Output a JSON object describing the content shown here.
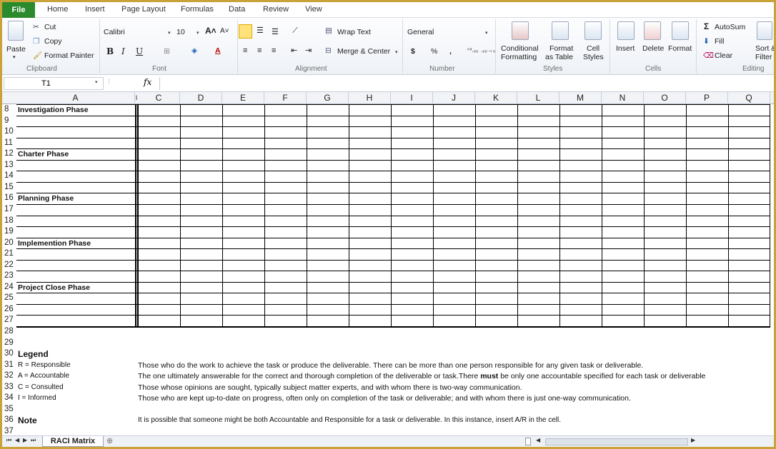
{
  "ribbon_tabs": {
    "file": "File",
    "home": "Home",
    "insert": "Insert",
    "page_layout": "Page Layout",
    "formulas": "Formulas",
    "data": "Data",
    "review": "Review",
    "view": "View"
  },
  "clipboard": {
    "paste": "Paste",
    "cut": "Cut",
    "copy": "Copy",
    "format_painter": "Format Painter",
    "group": "Clipboard"
  },
  "font": {
    "name": "Calibri",
    "size": "10",
    "bold": "B",
    "italic": "I",
    "underline": "U",
    "group": "Font"
  },
  "alignment": {
    "wrap_text": "Wrap Text",
    "merge_center": "Merge & Center",
    "group": "Alignment"
  },
  "number": {
    "format": "General",
    "currency": "$",
    "percent": "%",
    "comma": ",",
    "group": "Number"
  },
  "styles": {
    "conditional": "Conditional",
    "conditional2": "Formatting",
    "format_as": "Format",
    "format_as2": "as Table",
    "cell_styles": "Cell",
    "cell_styles2": "Styles",
    "group": "Styles"
  },
  "cells": {
    "insert": "Insert",
    "delete": "Delete",
    "format": "Format",
    "group": "Cells"
  },
  "editing": {
    "autosum": "AutoSum",
    "fill": "Fill",
    "clear": "Clear",
    "sort": "Sort &",
    "filter": "Filter",
    "group": "Editing"
  },
  "formula_bar": {
    "name_box": "T1",
    "fx": "fx",
    "value": ""
  },
  "columns": [
    "A",
    "I",
    "C",
    "D",
    "E",
    "F",
    "G",
    "H",
    "I",
    "J",
    "K",
    "L",
    "M",
    "N",
    "O",
    "P",
    "Q"
  ],
  "rows": [
    "8",
    "9",
    "10",
    "11",
    "12",
    "13",
    "14",
    "15",
    "16",
    "17",
    "18",
    "19",
    "20",
    "21",
    "22",
    "23",
    "24",
    "25",
    "26",
    "27",
    "28",
    "29",
    "30",
    "31",
    "32",
    "33",
    "34",
    "35",
    "36",
    "37"
  ],
  "phases": {
    "r8": "Investigation Phase",
    "r12": "Charter Phase",
    "r16": "Planning Phase",
    "r20": "Implemention Phase",
    "r24": "Project Close Phase"
  },
  "legend": {
    "title": "Legend",
    "r_code": "R = Responsible",
    "r_desc": "Those who do the work to achieve the task or produce the deliverable. There can be more than one person responsible for any given task or deliverable.",
    "a_code": "A = Accountable",
    "a_desc_pre": "The one ultimately answerable for the correct and thorough completion of the deliverable or task.There ",
    "a_desc_bold": "must",
    "a_desc_post": " be only one accountable specified for each task or deliverable",
    "c_code": "C = Consulted",
    "c_desc": "Those whose opinions are sought, typically subject matter experts, and with whom there is two-way communication.",
    "i_code": "I = Informed",
    "i_desc": "Those who are kept up-to-date on progress, often only on completion of the task or deliverable; and with whom there is just one-way communication."
  },
  "note": {
    "title": "Note",
    "text": "It is possible that someone might be both Accountable and Responsible for a task or deliverable. In this instance, insert A/R in the cell."
  },
  "sheet": {
    "tab": "RACI Matrix"
  }
}
